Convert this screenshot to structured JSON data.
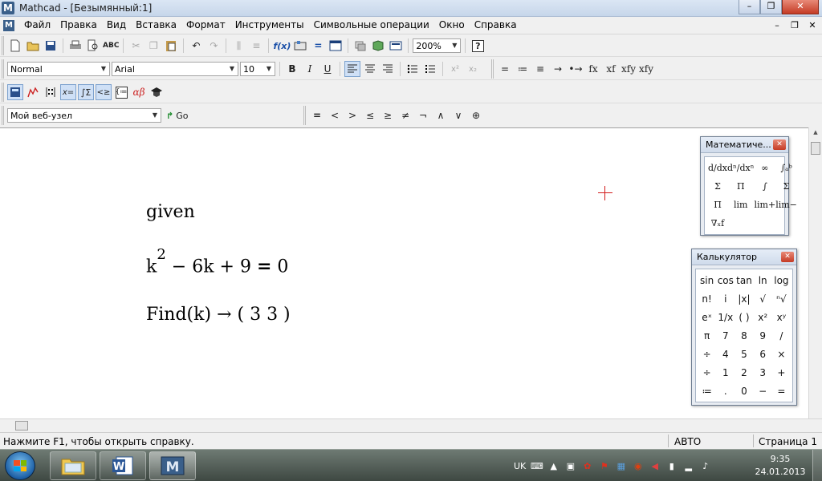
{
  "window": {
    "title": "Mathcad - [Безымянный:1]",
    "app_icon_letter": "M",
    "controls": {
      "minimize": "–",
      "maximize": "❐",
      "close": "✕"
    }
  },
  "menu": {
    "items": [
      "Файл",
      "Правка",
      "Вид",
      "Вставка",
      "Формат",
      "Инструменты",
      "Символьные операции",
      "Окно",
      "Справка"
    ],
    "doc_controls": {
      "minimize": "–",
      "restore": "❐",
      "close": "✕"
    }
  },
  "toolbar": {
    "zoom": "200%",
    "style": "Normal",
    "font": "Arial",
    "font_size": "10",
    "format_buttons": {
      "bold": "B",
      "italic": "I",
      "underline": "U"
    },
    "symbol_buttons": [
      "=",
      "≔",
      "≡",
      "→",
      "•→",
      "fx",
      "xf",
      "xfy",
      "xfy"
    ],
    "web": {
      "address": "Мой веб-узел",
      "go_label": "Go"
    },
    "boolean_buttons": [
      "=",
      "<",
      ">",
      "≤",
      "≥",
      "≠",
      "¬",
      "∧",
      "∨",
      "⊕"
    ]
  },
  "worksheet": {
    "given": "given",
    "equation": {
      "base": "k",
      "exponent": "2",
      "rest": "− 6k + 9",
      "equals": "=",
      "rhs": "0"
    },
    "find": {
      "call": "Find(k)",
      "arrow": "→",
      "result": "( 3   3 )"
    }
  },
  "math_palette": {
    "title": "Математиче...",
    "buttons": [
      "d/dx",
      "dⁿ/dxⁿ",
      "∞",
      "∫ₐᵇ",
      "Σ",
      "Π",
      "∫",
      "Σ",
      "Π",
      "lim",
      "lim+",
      "lim−",
      "∇ₓf"
    ]
  },
  "calculator": {
    "title": "Калькулятор",
    "buttons": [
      "sin",
      "cos",
      "tan",
      "ln",
      "log",
      "n!",
      "i",
      "|x|",
      "√",
      "ⁿ√",
      "eˣ",
      "1/x",
      "( )",
      "x²",
      "xʸ",
      "π",
      "7",
      "8",
      "9",
      "/",
      "÷",
      "4",
      "5",
      "6",
      "×",
      "÷",
      "1",
      "2",
      "3",
      "+",
      "≔",
      ".",
      "0",
      "−",
      "="
    ]
  },
  "status": {
    "help": "Нажмите F1, чтобы открыть справку.",
    "mode": "АВТО",
    "page": "Страница 1"
  },
  "taskbar": {
    "language": "UK",
    "time": "9:35",
    "date": "24.01.2013",
    "tasks": [
      "explorer-icon",
      "word-icon",
      "mathcad-icon"
    ]
  },
  "colors": {
    "cursor": "#d21a1a",
    "word_blue": "#2b5797",
    "mathcad_blue": "#3a5f8a"
  }
}
